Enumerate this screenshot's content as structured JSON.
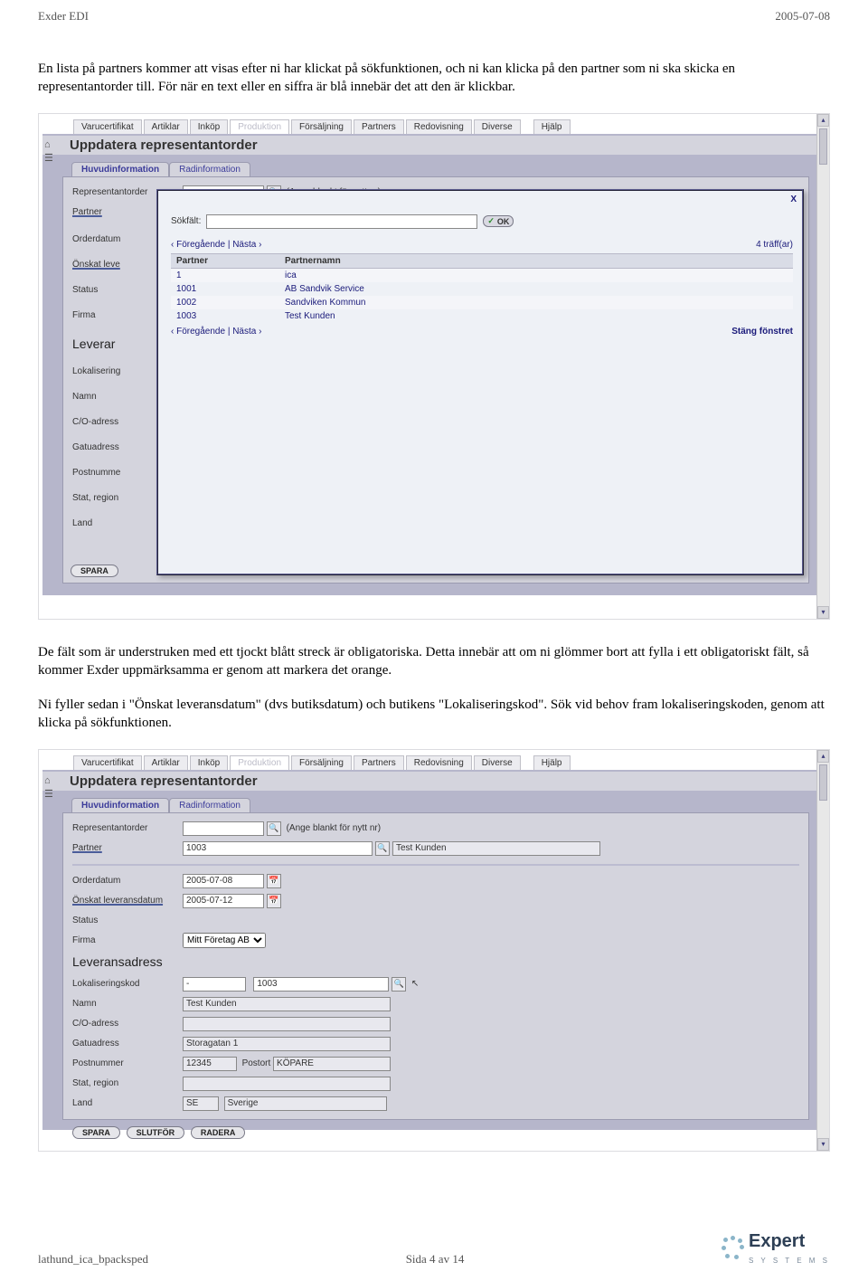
{
  "header": {
    "left": "Exder EDI",
    "right": "2005-07-08"
  },
  "paragraphs": {
    "p1": "En lista på partners kommer att visas efter ni har klickat på sökfunktionen, och ni kan klicka på den partner som ni ska skicka en representantorder till. För när en text eller en siffra är blå innebär det att den är klickbar.",
    "p2": "De fält som är understruken med ett tjockt blått streck är obligatoriska. Detta innebär att om ni glömmer bort att fylla i ett obligatoriskt fält, så kommer Exder uppmärksamma er genom att markera det orange.",
    "p3": "Ni fyller sedan i \"Önskat leveransdatum\" (dvs butiksdatum) och butikens \"Lokaliseringskod\". Sök vid behov fram lokaliseringskoden, genom att klicka på sökfunktionen."
  },
  "menus": [
    "Varucertifikat",
    "Artiklar",
    "Inköp",
    "Produktion",
    "Försäljning",
    "Partners",
    "Redovisning",
    "Diverse",
    "Hjälp"
  ],
  "screen": {
    "title": "Uppdatera representantorder",
    "tabs": [
      "Huvudinformation",
      "Radinformation"
    ],
    "hint": "(Ange blankt för nytt nr)",
    "labels": {
      "repOrder": "Representantorder",
      "partner": "Partner",
      "orderdatum": "Orderdatum",
      "onskat": "Önskat leveransdatum",
      "onskatShort": "Önskat leve",
      "status": "Status",
      "firma": "Firma",
      "leverans": "Leveransadress",
      "lokkod": "Lokaliseringskod",
      "namn": "Namn",
      "co": "C/O-adress",
      "gatu": "Gatuadress",
      "postnr": "Postnummer",
      "postort": "Postort",
      "stat": "Stat, region",
      "land": "Land"
    },
    "buttons": {
      "spara": "SPARA",
      "slutfor": "SLUTFÖR",
      "radera": "RADERA"
    }
  },
  "popup": {
    "sokfalt": "Sökfält:",
    "ok": "OK",
    "close": "X",
    "prev": "‹ Föregående",
    "next": "Nästa ›",
    "count": "4 träff(ar)",
    "stang": "Stäng fönstret",
    "cols": [
      "Partner",
      "Partnernamn"
    ],
    "rows": [
      {
        "p": "1",
        "n": "ica"
      },
      {
        "p": "1001",
        "n": "AB Sandvik Service"
      },
      {
        "p": "1002",
        "n": "Sandviken Kommun"
      },
      {
        "p": "1003",
        "n": "Test Kunden"
      }
    ],
    "sideForm": [
      "Orderdatum",
      "Önskat leve",
      "Status",
      "Firma",
      "Leverar",
      "Lokalisering",
      "Namn",
      "C/O-adress",
      "Gatuadress",
      "Postnumme",
      "Stat, region",
      "Land"
    ]
  },
  "shot2": {
    "partner": "1003",
    "partnerName": "Test Kunden",
    "orderdatum": "2005-07-08",
    "onskat": "2005-07-12",
    "firma": "Mitt Företag AB",
    "lokkod": "-",
    "lokkod2": "1003",
    "namn": "Test Kunden",
    "gatu": "Storagatan 1",
    "postnr": "12345",
    "postort": "KÖPARE",
    "land1": "SE",
    "land2": "Sverige"
  },
  "footer": {
    "left": "lathund_ica_bpacksped",
    "mid": "Sida 4 av 14",
    "logo": "Expert",
    "logosub": "S Y S T E M S"
  }
}
